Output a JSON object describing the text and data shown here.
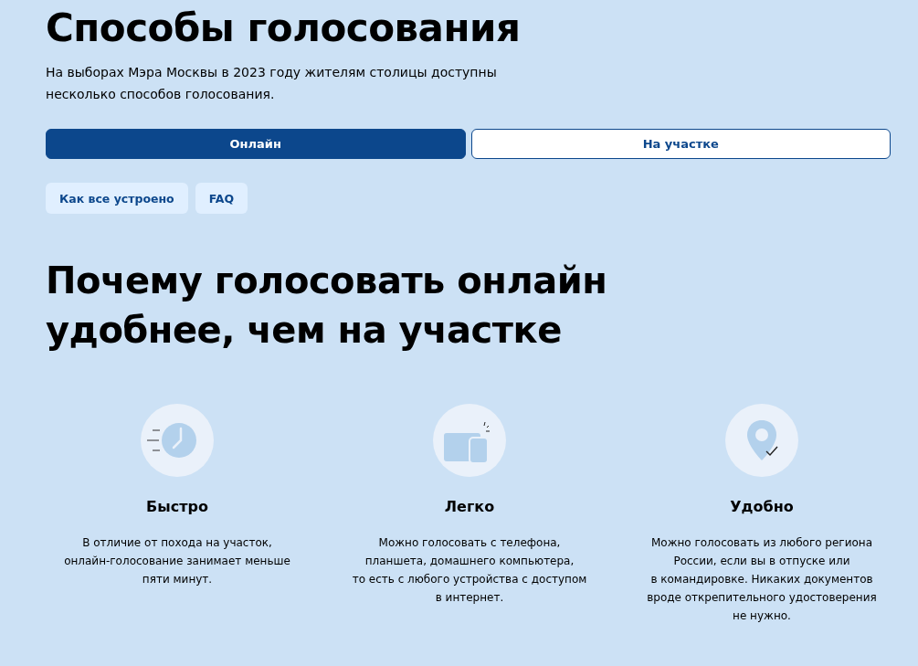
{
  "title": "Способы голосования",
  "intro": "На выборах Мэра Москвы в 2023 году жителям столицы доступны\nнесколько способов голосования.",
  "tabs": [
    {
      "label": "Онлайн",
      "selected": true
    },
    {
      "label": "На участке",
      "selected": false
    }
  ],
  "chips": [
    "Как все устроено",
    "FAQ"
  ],
  "section_title": "Почему голосовать онлайн\nудобнее, чем на участке",
  "features": [
    {
      "kind": "clock",
      "title": "Быстро",
      "text": "В отличие от похода на участок,\nонлайн-голосование занимает меньше\nпяти минут."
    },
    {
      "kind": "devices",
      "title": "Легко",
      "text": "Можно голосовать с телефона,\nпланшета, домашнего компьютера,\nто есть с любого устройства с доступом\nв интернет."
    },
    {
      "kind": "pin",
      "title": "Удобно",
      "text": "Можно голосовать из любого региона\nРоссии, если вы в отпуске или\nв командировке. Никаких документов\nвроде открепительного удостоверения\nне нужно."
    }
  ]
}
